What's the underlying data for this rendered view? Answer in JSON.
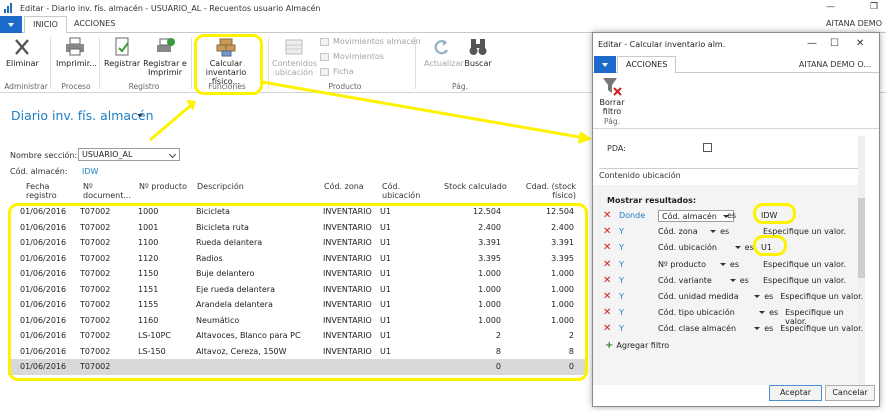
{
  "window": {
    "title": "Editar - Diario inv. fís. almacén - USUARIO_AL - Recuentos usuario Almacén",
    "user": "AITANA DEMO",
    "minimize": "—",
    "restore": "❐"
  },
  "ribbon_tabs": [
    "INICIO",
    "ACCIONES"
  ],
  "ribbon": {
    "eliminar": "Eliminar",
    "imprimir": "Imprimir...",
    "registrar": "Registrar",
    "registrar_imprimir": "Registrar e Imprimir",
    "calcular": "Calcular inventario físico...",
    "contenidos": "Contenidos ubicación",
    "movimientos_almacen": "Movimientos almacén",
    "movimientos": "Movimientos",
    "ficha": "Ficha",
    "actualizar": "Actualizar",
    "buscar": "Buscar",
    "groups": [
      "Administrar",
      "Proceso",
      "Registro",
      "Funciones",
      "Producto",
      "Pág."
    ]
  },
  "page": {
    "title": "Diario inv. fís. almacén",
    "seccion_label": "Nombre sección:",
    "seccion_value": "USUARIO_AL",
    "almacen_label": "Cód. almacén:",
    "almacen_value": "IDW"
  },
  "grid": {
    "columns": [
      "Fecha registro",
      "Nº document...",
      "Nº producto",
      "Descripción",
      "Cód. zona",
      "Cód. ubicación",
      "Stock calculado",
      "Cdad. (stock físico)"
    ],
    "rows": [
      [
        "01/06/2016",
        "T07002",
        "1000",
        "Bicicleta",
        "INVENTARIO",
        "U1",
        "12.504",
        "12.504"
      ],
      [
        "01/06/2016",
        "T07002",
        "1001",
        "Bicicleta ruta",
        "INVENTARIO",
        "U1",
        "2.400",
        "2.400"
      ],
      [
        "01/06/2016",
        "T07002",
        "1100",
        "Rueda delantera",
        "INVENTARIO",
        "U1",
        "3.391",
        "3.391"
      ],
      [
        "01/06/2016",
        "T07002",
        "1120",
        "Radios",
        "INVENTARIO",
        "U1",
        "3.395",
        "3.395"
      ],
      [
        "01/06/2016",
        "T07002",
        "1150",
        "Buje delantero",
        "INVENTARIO",
        "U1",
        "1.000",
        "1.000"
      ],
      [
        "01/06/2016",
        "T07002",
        "1151",
        "Eje rueda delantera",
        "INVENTARIO",
        "U1",
        "1.000",
        "1.000"
      ],
      [
        "01/06/2016",
        "T07002",
        "1155",
        "Arandela delantera",
        "INVENTARIO",
        "U1",
        "1.000",
        "1.000"
      ],
      [
        "01/06/2016",
        "T07002",
        "1160",
        "Neumático",
        "INVENTARIO",
        "U1",
        "1.000",
        "1.000"
      ],
      [
        "01/06/2016",
        "T07002",
        "LS-10PC",
        "Altavoces, Blanco para PC",
        "INVENTARIO",
        "U1",
        "2",
        "2"
      ],
      [
        "01/06/2016",
        "T07002",
        "LS-150",
        "Altavoz, Cereza, 150W",
        "INVENTARIO",
        "U1",
        "8",
        "8"
      ],
      [
        "01/06/2016",
        "T07002",
        "",
        "",
        "",
        "",
        "0",
        "0"
      ]
    ]
  },
  "dialog": {
    "title": "Editar - Calcular inventario alm.",
    "tab": "ACCIONES",
    "company": "AITANA DEMO O...",
    "borrar_filtro": "Borrar filtro",
    "group": "Pág.",
    "pda_label": "PDA:",
    "section": "Contenido ubicación",
    "filters_title": "Mostrar resultados:",
    "filters": [
      {
        "conn": "Donde",
        "field": "Cód. almacén",
        "op": "es",
        "value": "IDW"
      },
      {
        "conn": "Y",
        "field": "Cód. zona",
        "op": "es",
        "value": "Especifique un valor."
      },
      {
        "conn": "Y",
        "field": "Cód. ubicación",
        "op": "es",
        "value": "U1"
      },
      {
        "conn": "Y",
        "field": "Nº producto",
        "op": "es",
        "value": "Especifique un valor."
      },
      {
        "conn": "Y",
        "field": "Cód. variante",
        "op": "es",
        "value": "Especifique un valor."
      },
      {
        "conn": "Y",
        "field": "Cód. unidad medida",
        "op": "es",
        "value": "Especifique un valor."
      },
      {
        "conn": "Y",
        "field": "Cód. tipo ubicación",
        "op": "es",
        "value": "Especifique un valor."
      },
      {
        "conn": "Y",
        "field": "Cód. clase almacén",
        "op": "es",
        "value": "Especifique un valor."
      }
    ],
    "add_filter": "Agregar filtro",
    "aceptar": "Aceptar",
    "cancelar": "Cancelar",
    "minimize": "—",
    "maximize": "☐",
    "close": "✕"
  },
  "colors": {
    "accent": "#1b6ac9",
    "link": "#1d7fc3",
    "highlight": "#fff200",
    "delete": "#d02020"
  }
}
